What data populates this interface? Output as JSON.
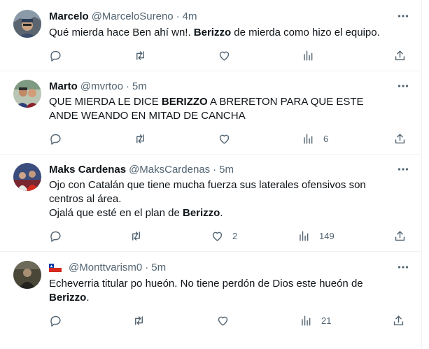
{
  "tweets": [
    {
      "display_name": "Marcelo",
      "handle": "@MarceloSureno",
      "dot": "·",
      "time": "4m",
      "text_parts": [
        "Qué mierda hace Ben ahí wn!. ",
        "Berizzo",
        " de mierda como hizo el equipo."
      ],
      "reply_count": "",
      "retweet_count": "",
      "like_count": "",
      "view_count": ""
    },
    {
      "display_name": "Marto",
      "handle": "@mvrtoo",
      "dot": "·",
      "time": "5m",
      "text_parts": [
        "QUE MIERDA LE DICE ",
        "BERIZZO",
        " A BRERETON PARA QUE ESTE ANDE WEANDO EN MITAD DE CANCHA"
      ],
      "reply_count": "",
      "retweet_count": "",
      "like_count": "",
      "view_count": "6"
    },
    {
      "display_name": "Maks Cardenas",
      "handle": "@MaksCardenas",
      "dot": "·",
      "time": "5m",
      "text_line1": "Ojo con Catalán que tiene mucha fuerza sus laterales ofensivos son centros al área.",
      "text_parts": [
        "Ojalá que esté en el plan de ",
        "Berizzo",
        "."
      ],
      "reply_count": "",
      "retweet_count": "",
      "like_count": "2",
      "view_count": "149"
    },
    {
      "display_name": "",
      "handle": "@Monttvarism0",
      "dot": "·",
      "time": "5m",
      "text_parts": [
        "Echeverria titular po hueón. No tiene perdón de Dios este hueón de ",
        "Berizzo",
        "."
      ],
      "reply_count": "",
      "retweet_count": "",
      "like_count": "",
      "view_count": "21"
    }
  ],
  "icons": {
    "more": "more-horizontal-icon",
    "reply": "reply-bubble-icon",
    "retweet": "retweet-arrows-icon",
    "like": "heart-icon",
    "views": "bar-chart-icon",
    "share": "share-upload-icon",
    "flag": "chile-flag-icon"
  },
  "colors": {
    "text": "#0f1419",
    "secondary": "#536471",
    "divider": "#eff3f4",
    "chile_red": "#d52b1e",
    "chile_blue": "#0039a6"
  }
}
